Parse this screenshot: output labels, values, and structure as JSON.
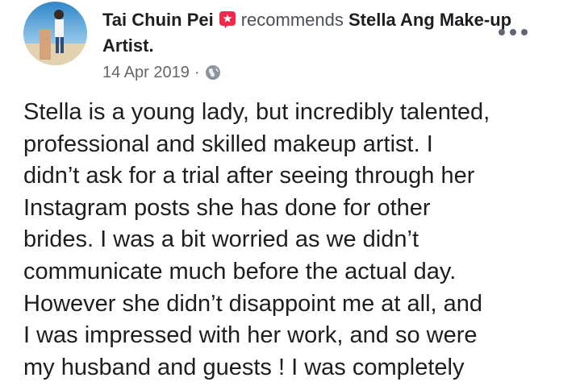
{
  "post": {
    "author": "Tai Chuin Pei",
    "verb": "recommends",
    "page": "Stella Ang Make-up Artist.",
    "date": "14 Apr 2019",
    "separator": "·",
    "privacy_icon": "globe-icon",
    "recommend_icon": "recommend-badge-icon",
    "more_icon": "more-options-icon",
    "accent_color": "#f02849",
    "body_lines": [
      "Stella is a young lady, but incredibly talented,",
      "professional and skilled makeup artist. I",
      "didn’t ask for a trial after seeing through her",
      "Instagram posts she has done for other",
      "brides. I was a bit worried as we didn’t",
      "communicate much before the actual day.",
      "However she didn’t disappoint me at all, and",
      "I was impressed with her work, and so were",
      "my husband and guests ! I was completely"
    ]
  }
}
